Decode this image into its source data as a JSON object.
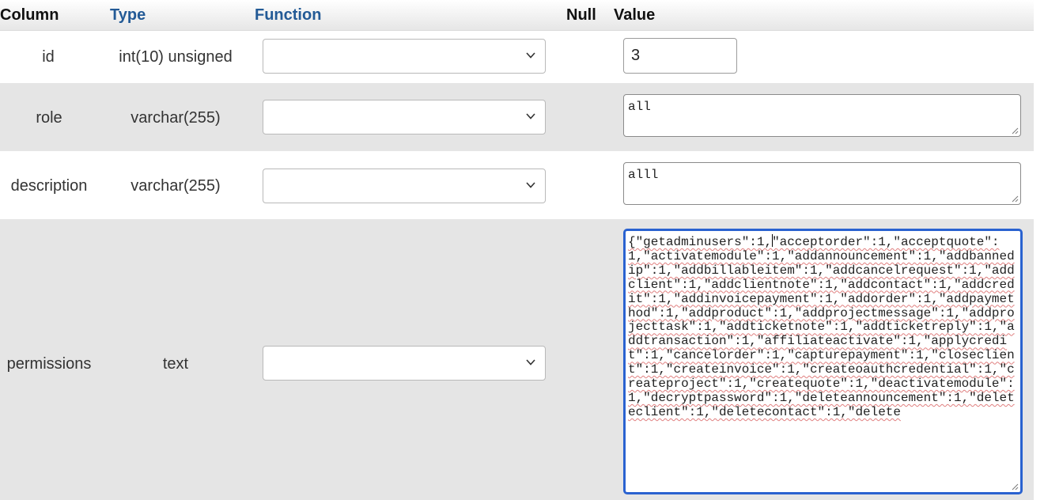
{
  "header": {
    "column": "Column",
    "type": "Type",
    "function": "Function",
    "null": "Null",
    "value": "Value"
  },
  "rows": [
    {
      "column": "id",
      "type": "int(10) unsigned",
      "function": "",
      "value": "3"
    },
    {
      "column": "role",
      "type": "varchar(255)",
      "function": "",
      "value": "all"
    },
    {
      "column": "description",
      "type": "varchar(255)",
      "function": "",
      "value": "alll"
    },
    {
      "column": "permissions",
      "type": "text",
      "function": "",
      "value_before_caret": "{\"getadminusers\":1,",
      "value_after_caret": "\"acceptorder\":1,\"acceptquote\":1,\"activatemodule\":1,\"addannouncement\":1,\"addbannedip\":1,\"addbillableitem\":1,\"addcancelrequest\":1,\"addclient\":1,\"addclientnote\":1,\"addcontact\":1,\"addcredit\":1,\"addinvoicepayment\":1,\"addorder\":1,\"addpaymethod\":1,\"addproduct\":1,\"addprojectmessage\":1,\"addprojecttask\":1,\"addticketnote\":1,\"addticketreply\":1,\"addtransaction\":1,\"affiliateactivate\":1,\"applycredit\":1,\"cancelorder\":1,\"capturepayment\":1,\"closeclient\":1,\"createinvoice\":1,\"createoauthcredential\":1,\"createproject\":1,\"createquote\":1,\"deactivatemodule\":1,\"decryptpassword\":1,\"deleteannouncement\":1,\"deleteclient\":1,\"deletecontact\":1,\"delete"
    }
  ],
  "colors": {
    "link": "#235a96",
    "row_alt": "#e5e5e5",
    "focus": "#2a62d0"
  },
  "icons": {
    "select_arrow": "chevron-down-icon",
    "resize": "resize-grip-icon"
  }
}
